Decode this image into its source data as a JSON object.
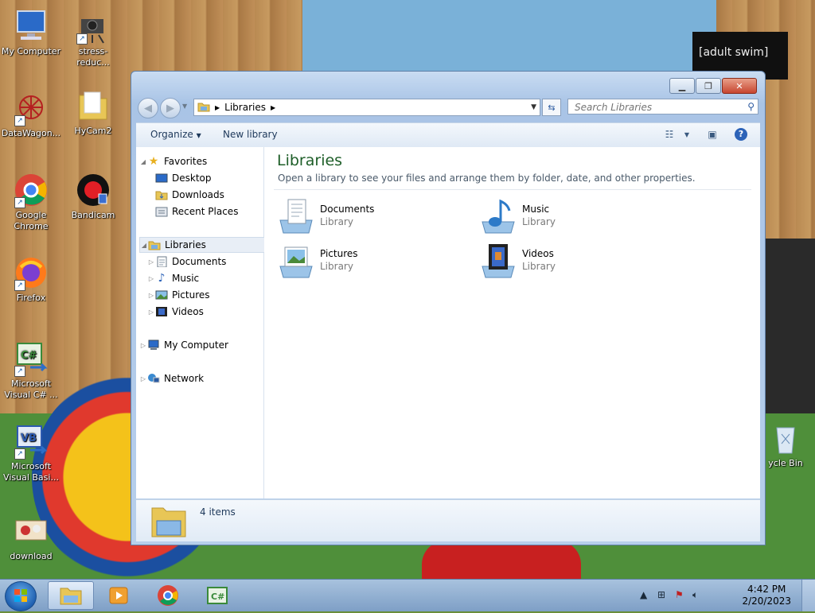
{
  "desktop": {
    "icons": [
      {
        "label": "My Computer"
      },
      {
        "label": "stress-reduc..."
      },
      {
        "label": "DataWagon..."
      },
      {
        "label": "HyCam2"
      },
      {
        "label": "Google Chrome"
      },
      {
        "label": "Bandicam"
      },
      {
        "label": "Firefox"
      },
      {
        "label": "Microsoft Visual C# ..."
      },
      {
        "label": "Microsoft Visual Basi..."
      },
      {
        "label": "download"
      },
      {
        "label": "ycle Bin"
      }
    ],
    "wallpaper_text": "[adult swim]"
  },
  "window": {
    "address": {
      "crumb": "Libraries"
    },
    "search": {
      "placeholder": "Search Libraries"
    },
    "toolbar": {
      "organize": "Organize",
      "new_library": "New library"
    },
    "nav": {
      "favorites": "Favorites",
      "favorites_items": [
        "Desktop",
        "Downloads",
        "Recent Places"
      ],
      "libraries": "Libraries",
      "libraries_items": [
        "Documents",
        "Music",
        "Pictures",
        "Videos"
      ],
      "my_computer": "My Computer",
      "network": "Network"
    },
    "content": {
      "title": "Libraries",
      "subtitle": "Open a library to see your files and arrange them by folder, date, and other properties.",
      "items": [
        {
          "name": "Documents",
          "type": "Library"
        },
        {
          "name": "Music",
          "type": "Library"
        },
        {
          "name": "Pictures",
          "type": "Library"
        },
        {
          "name": "Videos",
          "type": "Library"
        }
      ]
    },
    "details": {
      "count": "4 items"
    }
  },
  "taskbar": {
    "clock_time": "4:42 PM",
    "clock_date": "2/20/2023"
  },
  "colors": {
    "accent": "#1e5e28",
    "selection": "#e8eef6"
  }
}
